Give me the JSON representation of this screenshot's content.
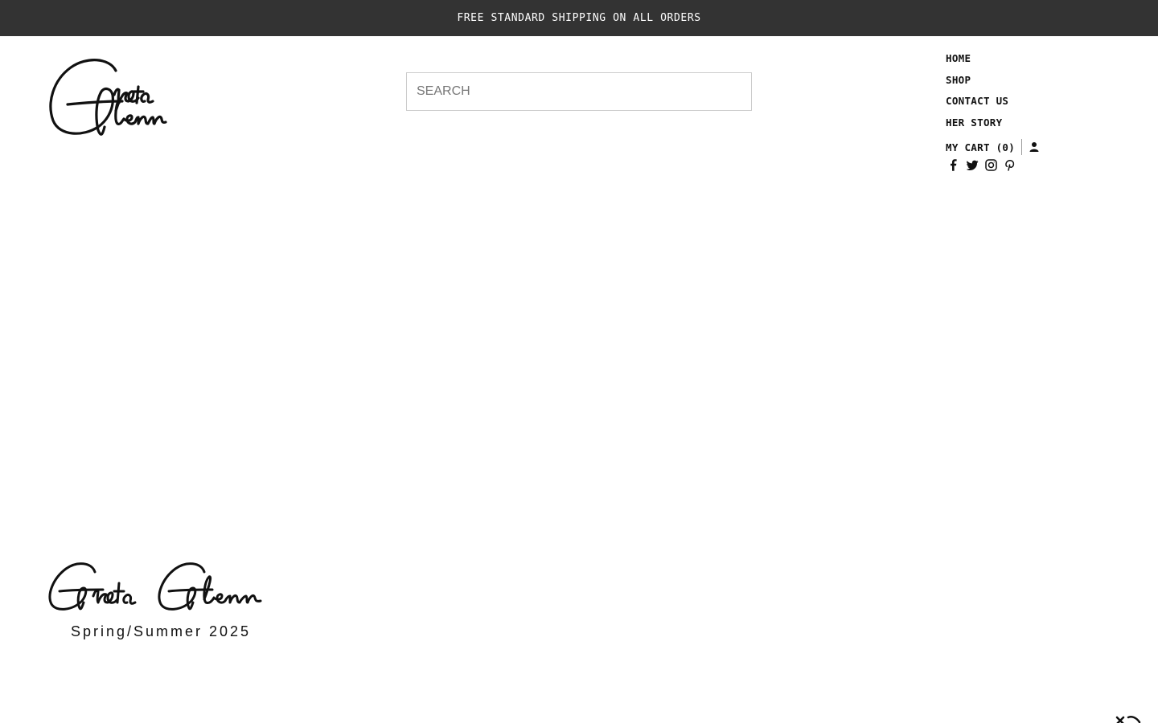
{
  "announcement": {
    "text": "FREE STANDARD SHIPPING ON ALL ORDERS"
  },
  "brand": {
    "logo_text": "Greta Glenn"
  },
  "search": {
    "placeholder": "SEARCH"
  },
  "nav": {
    "items": [
      {
        "label": "HOME"
      },
      {
        "label": "SHOP"
      },
      {
        "label": "CONTACT US"
      },
      {
        "label": "HER STORY"
      }
    ],
    "cart_label": "MY CART (0)",
    "social_icons": [
      "facebook-icon",
      "twitter-icon",
      "instagram-icon",
      "pinterest-icon"
    ]
  },
  "hero": {
    "title": "Greta Glenn",
    "subtitle": "Spring/Summer 2025"
  },
  "colors": {
    "announcement_bg": "#333333",
    "text": "#111111",
    "background": "#ffffff"
  }
}
